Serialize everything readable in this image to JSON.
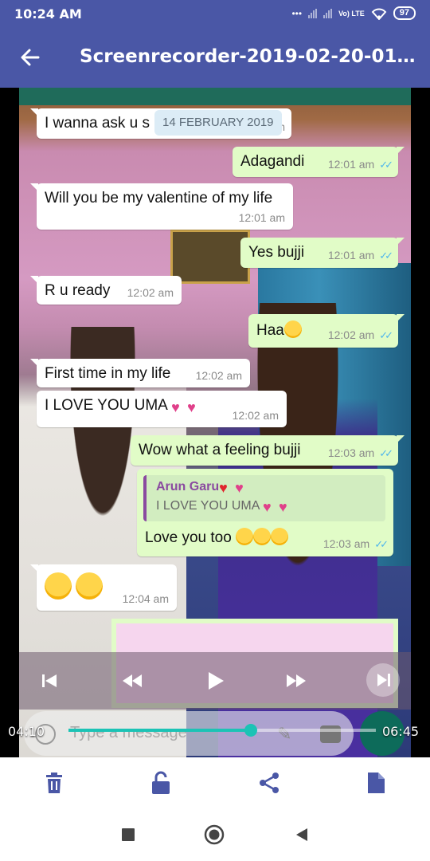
{
  "status_bar": {
    "time": "10:24 AM",
    "network": "Vo) LTE",
    "battery": "97"
  },
  "app_bar": {
    "title": "Screenrecorder-2019-02-20-01-..."
  },
  "chat": {
    "date_chip": "14 FEBRUARY 2019",
    "messages": [
      {
        "dir": "in",
        "text": "I wanna ask u s",
        "time": "m"
      },
      {
        "dir": "out",
        "text": "Adagandi",
        "time": "12:01 am"
      },
      {
        "dir": "in",
        "text": "Will you be my valentine of my life",
        "time": "12:01 am"
      },
      {
        "dir": "out",
        "text": "Yes bujji",
        "time": "12:01 am"
      },
      {
        "dir": "in",
        "text": "R u ready",
        "time": "12:02 am"
      },
      {
        "dir": "out",
        "text": "Haa",
        "time": "12:02 am"
      },
      {
        "dir": "in",
        "text": "First time in my life",
        "time": "12:02 am"
      },
      {
        "dir": "in",
        "text": "I LOVE YOU UMA",
        "time": "12:02 am"
      },
      {
        "dir": "out",
        "text": "Wow what a feeling bujji",
        "time": "12:03 am"
      },
      {
        "dir": "out",
        "quote_author": "Arun Garu",
        "quote_text": "I LOVE YOU UMA",
        "text": "Love you too",
        "time": "12:03 am"
      },
      {
        "dir": "in",
        "text": "",
        "time": "12:04 am"
      }
    ],
    "input_placeholder": "Type a message"
  },
  "player": {
    "current_time": "04:10",
    "total_time": "06:45",
    "progress": 0.592
  },
  "actions": {
    "delete": "delete-icon",
    "unlock": "unlock-icon",
    "share": "share-icon",
    "file": "file-icon"
  },
  "colors": {
    "app_bar": "#4a57a6",
    "outgoing": "#e1fcc7",
    "incoming": "#ffffff",
    "seek": "#1cc3b5",
    "ticks": "#4fb6ec",
    "icon": "#4a57a6"
  }
}
